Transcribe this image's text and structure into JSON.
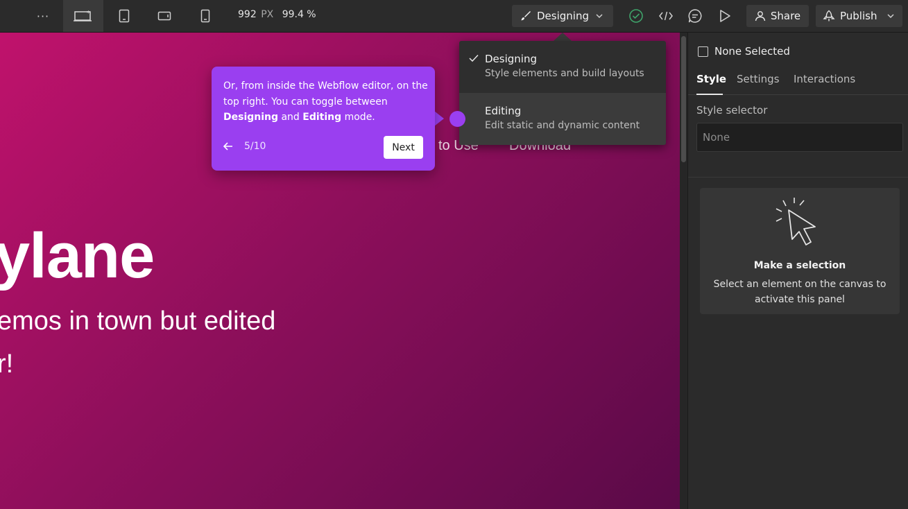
{
  "toolbar": {
    "more_label": "···",
    "canvas_width": "992",
    "canvas_width_unit": "PX",
    "zoom": "99.4 %",
    "mode_label": "Designing",
    "share_label": "Share",
    "publish_label": "Publish"
  },
  "canvas": {
    "nav_items": [
      "to Use",
      "Download"
    ],
    "hero_title": "ylane",
    "hero_line_1": "emos in town but edited",
    "hero_line_2": "r!"
  },
  "mode_menu": {
    "items": [
      {
        "title": "Designing",
        "description": "Style elements and build layouts",
        "selected": true
      },
      {
        "title": "Editing",
        "description": "Edit static and dynamic content",
        "selected": false
      }
    ]
  },
  "tour": {
    "text_1": "Or, from inside the Webflow editor, on the top right. You can toggle between ",
    "bold_1": "Designing",
    "text_2": " and ",
    "bold_2": "Editing",
    "text_3": " mode.",
    "step": "5/10",
    "next_label": "Next"
  },
  "panel": {
    "selection_label": "None Selected",
    "tabs": [
      "Style",
      "Settings",
      "Interactions"
    ],
    "style_selector_label": "Style selector",
    "style_selector_placeholder": "None",
    "empty_title": "Make a selection",
    "empty_description": "Select an element on the canvas to activate this panel"
  },
  "colors": {
    "tour_accent": "#9a3ff0",
    "publish_ok": "#3fa36a"
  },
  "icons": {
    "desktop": "desktop-breakpoint-icon",
    "tablet": "tablet-breakpoint-icon",
    "landscape": "mobile-landscape-icon",
    "phone": "mobile-portrait-icon",
    "brush": "brush-icon",
    "check": "check-circle-icon",
    "code": "code-icon",
    "comment": "comment-icon",
    "play": "play-icon",
    "user": "user-icon",
    "rocket": "rocket-icon",
    "cursor": "cursor-click-icon"
  }
}
